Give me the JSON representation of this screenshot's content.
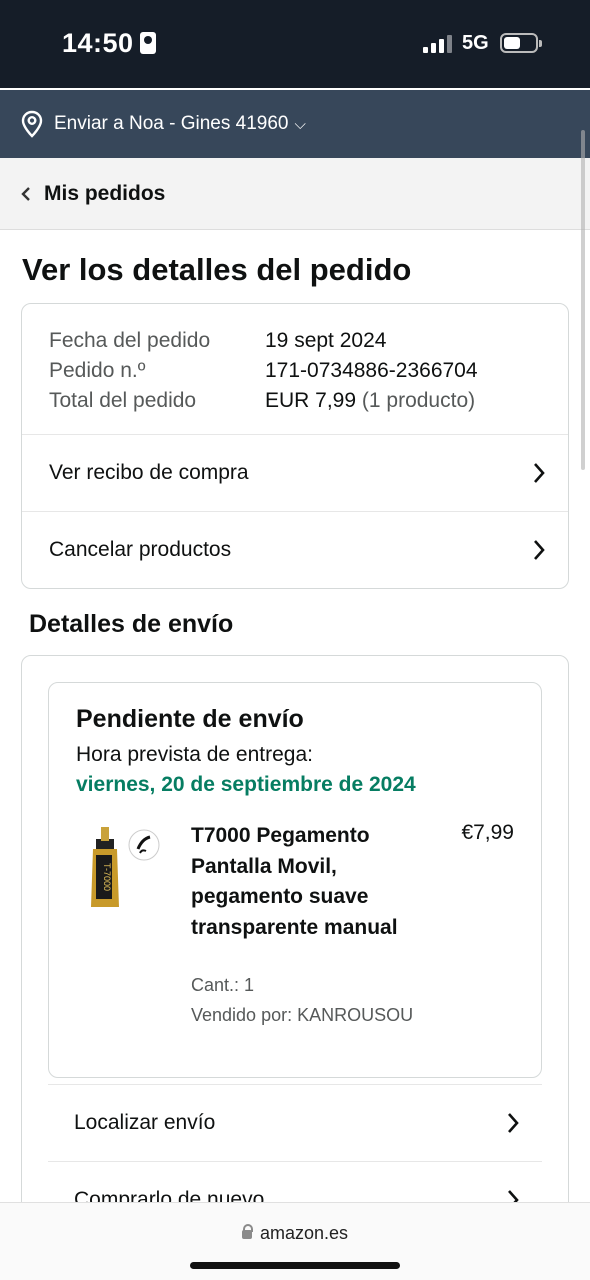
{
  "status_bar": {
    "time": "14:50",
    "network": "5G"
  },
  "delivery": {
    "text": "Enviar a Noa - Gines 41960",
    "icon": "location-pin-icon"
  },
  "nav": {
    "back_label": "Mis pedidos"
  },
  "page_title": "Ver los detalles del pedido",
  "summary": {
    "date_label": "Fecha del pedido",
    "date_value": "19 sept 2024",
    "order_label": "Pedido n.º",
    "order_value": "171-0734886-2366704",
    "total_label": "Total del pedido",
    "total_value": "EUR 7,99",
    "total_count": "(1 producto)",
    "receipt_link": "Ver recibo de compra",
    "cancel_link": "Cancelar productos"
  },
  "shipping": {
    "section_title": "Detalles de envío",
    "status": "Pendiente de envío",
    "eta_label": "Hora prevista de entrega:",
    "eta_date": "viernes, 20 de septiembre de 2024",
    "eta_color": "#067d62",
    "product": {
      "name": "T7000 Pegamento Pantalla Movil, pegamento suave transparente manual",
      "price": "€7,99",
      "qty": "Cant.: 1",
      "seller": "Vendido por: KANROUSOU"
    },
    "track_link": "Localizar envío",
    "buy_again_link": "Comprarlo de nuevo"
  },
  "browser": {
    "url": "amazon.es"
  },
  "colors": {
    "status_bg": "#151d28",
    "deliver_bg": "#37475a",
    "green": "#067d62"
  }
}
